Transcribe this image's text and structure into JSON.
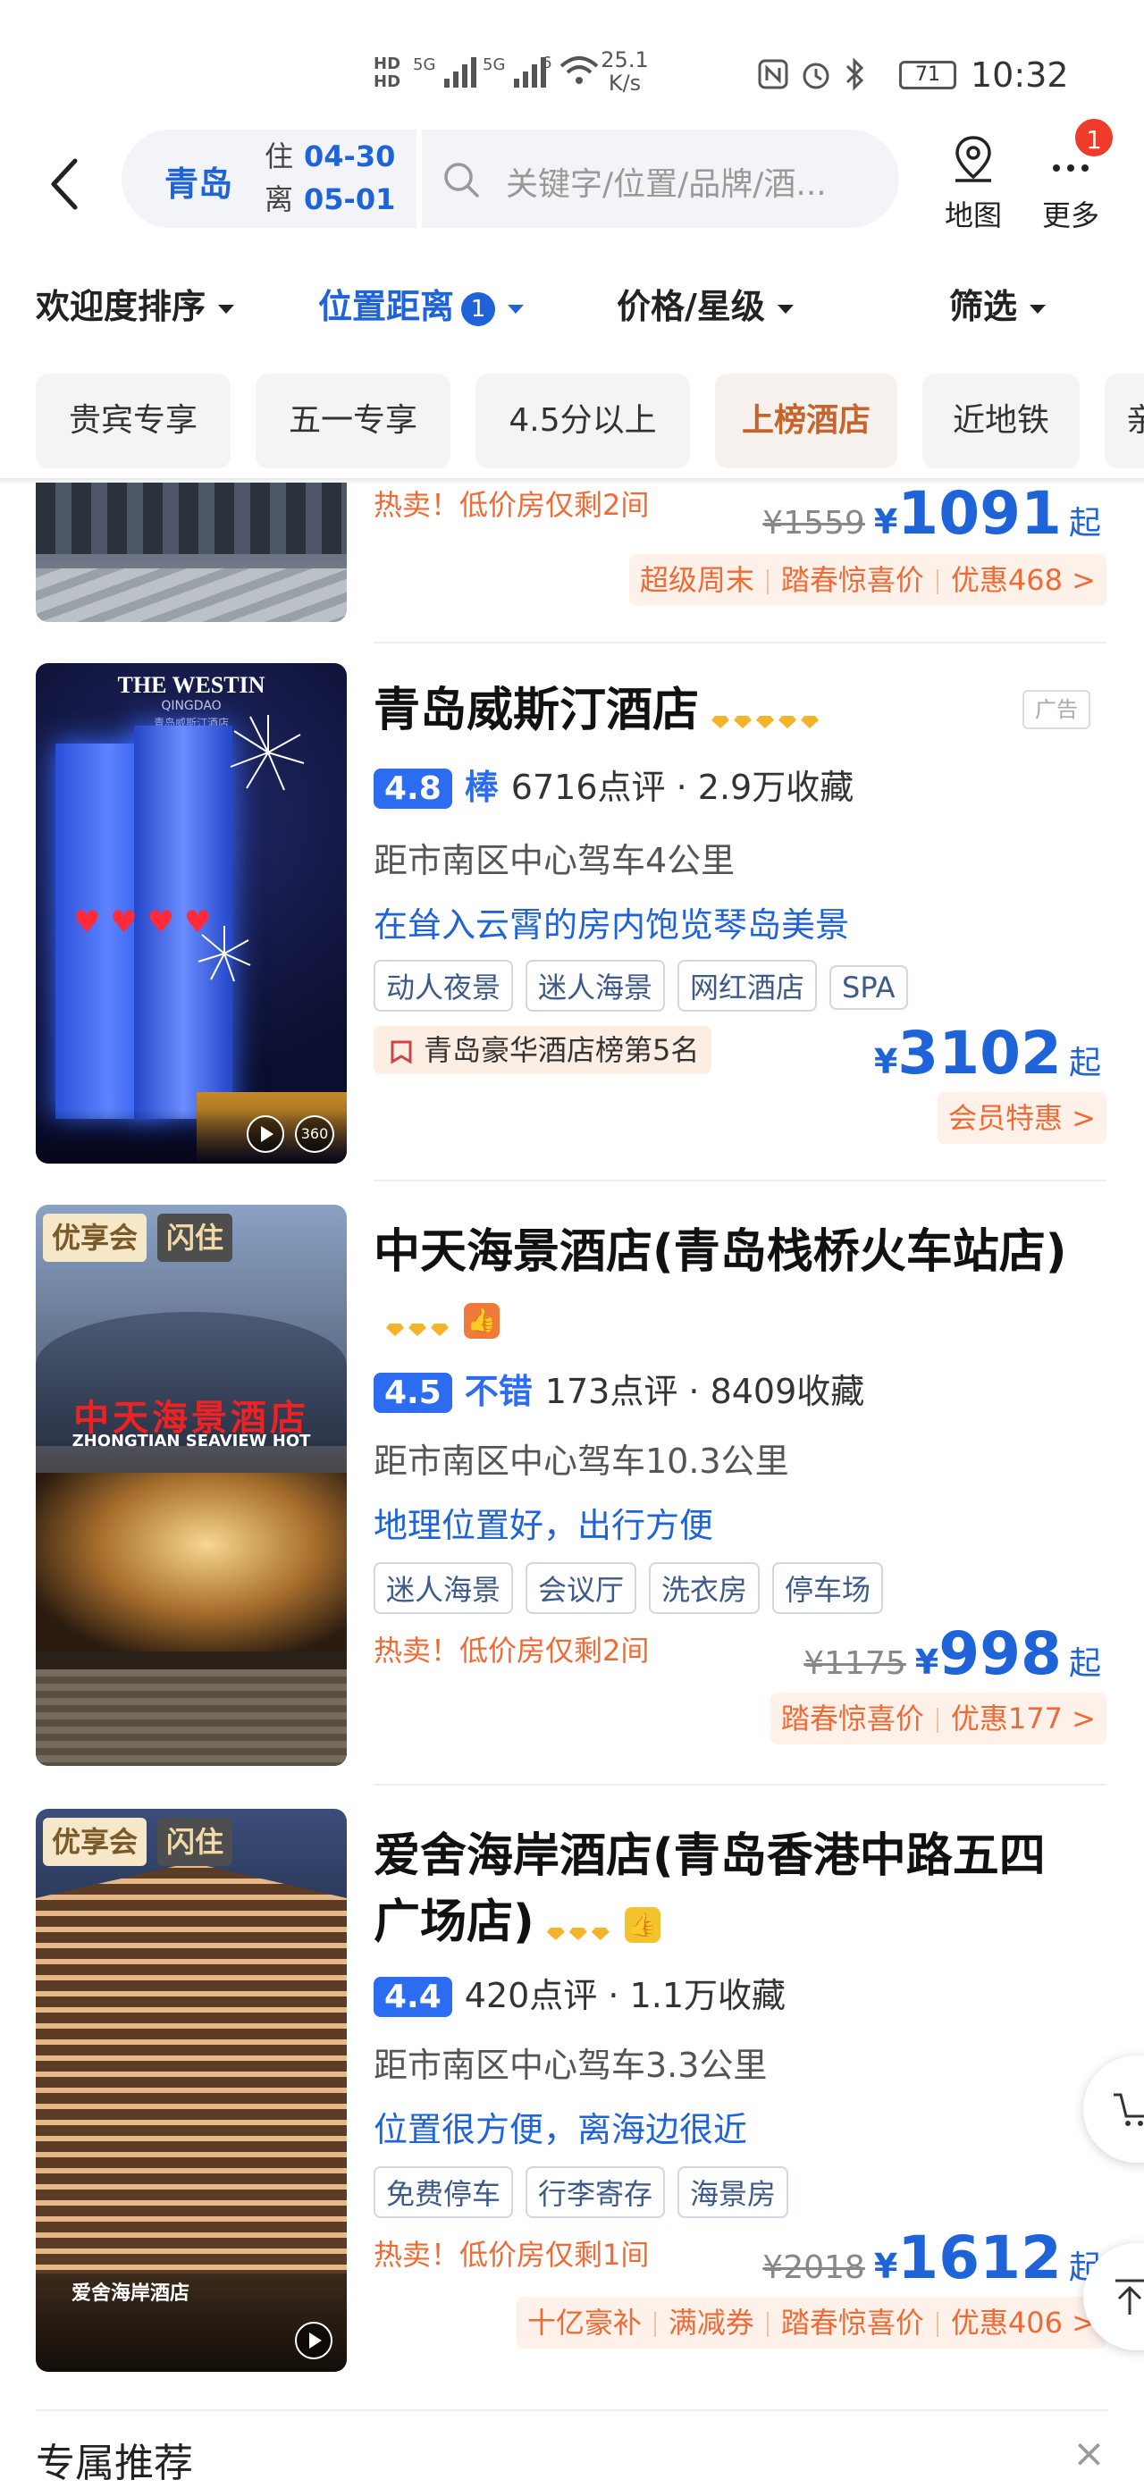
{
  "status_bar": {
    "hd1": "HD",
    "hd2": "HD",
    "sig1": "5G",
    "sig2": "5G",
    "wifi": "6",
    "speed_val": "25.1",
    "speed_unit": "K/s",
    "battery": "71",
    "time": "10:32"
  },
  "header": {
    "city": "青岛",
    "checkin_label": "住",
    "checkin_date": "04-30",
    "checkout_label": "离",
    "checkout_date": "05-01",
    "search_placeholder": "关键字/位置/品牌/酒...",
    "map_label": "地图",
    "more_label": "更多",
    "more_badge": "1"
  },
  "sort_bar": {
    "popularity": "欢迎度排序",
    "distance": "位置距离",
    "distance_badge": "1",
    "price_star": "价格/星级",
    "filter": "筛选"
  },
  "chips": [
    "贵宾专享",
    "五一专享",
    "4.5分以上",
    "上榜酒店",
    "近地铁",
    "亲"
  ],
  "hotels": [
    {
      "hot": "热卖！低价房仅剩2间",
      "old_price": "¥1559",
      "yen": "¥",
      "price": "1091",
      "unit": "起",
      "promos": [
        "超级周末",
        "踏春惊喜价",
        "优惠468 >"
      ]
    },
    {
      "name": "青岛威斯汀酒店",
      "stars": 5,
      "ad": "广告",
      "score": "4.8",
      "word": "棒",
      "reviews": "6716点评",
      "favs": "· 2.9万收藏",
      "distance": "距市南区中心驾车4公里",
      "highlight": "在耸入云霄的房内饱览琴岛美景",
      "tags": [
        "动人夜景",
        "迷人海景",
        "网红酒店",
        "SPA"
      ],
      "rank": "青岛豪华酒店榜第5名",
      "yen": "¥",
      "price": "3102",
      "unit": "起",
      "promos": [
        "会员特惠 >"
      ],
      "thumb_brand": "THE WESTIN",
      "thumb_sub": "QINGDAO",
      "thumb_cn": "青岛威斯汀酒店",
      "thumb_badge": "360"
    },
    {
      "name": "中天海景酒店(青岛栈桥火车站店)",
      "stars": 3,
      "score": "4.5",
      "word": "不错",
      "reviews": "173点评",
      "favs": "· 8409收藏",
      "distance": "距市南区中心驾车10.3公里",
      "highlight": "地理位置好，出行方便",
      "tags": [
        "迷人海景",
        "会议厅",
        "洗衣房",
        "停车场"
      ],
      "hot": "热卖！低价房仅剩2间",
      "old_price": "¥1175",
      "yen": "¥",
      "price": "998",
      "unit": "起",
      "promos": [
        "踏春惊喜价",
        "优惠177 >"
      ],
      "badge1": "优享会",
      "badge2": "闪住",
      "sign_cn": "中天海景酒店",
      "sign_en": "ZHONGTIAN SEAVIEW HOT"
    },
    {
      "name": "爱舍海岸酒店(青岛香港中路五四广场店)",
      "stars": 3,
      "score": "4.4",
      "reviews": "420点评",
      "favs": "· 1.1万收藏",
      "distance": "距市南区中心驾车3.3公里",
      "highlight": "位置很方便，离海边很近",
      "tags": [
        "免费停车",
        "行李寄存",
        "海景房"
      ],
      "hot": "热卖！低价房仅剩1间",
      "old_price": "¥2018",
      "yen": "¥",
      "price": "1612",
      "unit": "起",
      "promos": [
        "十亿豪补",
        "满减券",
        "踏春惊喜价",
        "优惠406 >"
      ],
      "badge1": "优享会",
      "badge2": "闪住",
      "sign_cn": "爱舍海岸酒店"
    }
  ],
  "section": {
    "title": "专属推荐",
    "close": "×"
  },
  "colors": {
    "accent": "#1f63d8",
    "orange": "#ef6a34",
    "star": "#f3b32b"
  }
}
